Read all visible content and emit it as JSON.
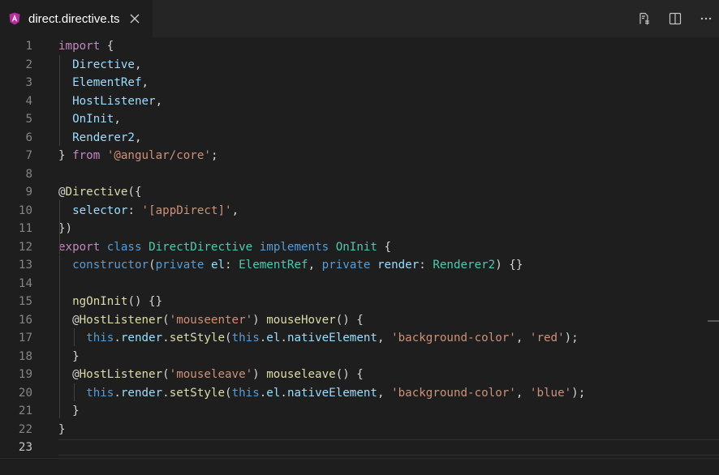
{
  "tab": {
    "filename": "direct.directive.ts",
    "icon": "angular-icon"
  },
  "actions": [
    {
      "name": "open-changes-icon"
    },
    {
      "name": "split-editor-icon"
    },
    {
      "name": "more-actions-icon"
    }
  ],
  "editor": {
    "active_line": 23,
    "lines": [
      {
        "n": "1",
        "tokens": [
          [
            "kw",
            "import"
          ],
          [
            "pu",
            " {"
          ]
        ]
      },
      {
        "n": "2",
        "tokens": [
          [
            "pu",
            "  "
          ],
          [
            "id",
            "Directive"
          ],
          [
            "pu",
            ","
          ]
        ]
      },
      {
        "n": "3",
        "tokens": [
          [
            "pu",
            "  "
          ],
          [
            "id",
            "ElementRef"
          ],
          [
            "pu",
            ","
          ]
        ]
      },
      {
        "n": "4",
        "tokens": [
          [
            "pu",
            "  "
          ],
          [
            "id",
            "HostListener"
          ],
          [
            "pu",
            ","
          ]
        ]
      },
      {
        "n": "5",
        "tokens": [
          [
            "pu",
            "  "
          ],
          [
            "id",
            "OnInit"
          ],
          [
            "pu",
            ","
          ]
        ]
      },
      {
        "n": "6",
        "tokens": [
          [
            "pu",
            "  "
          ],
          [
            "id",
            "Renderer2"
          ],
          [
            "pu",
            ","
          ]
        ]
      },
      {
        "n": "7",
        "tokens": [
          [
            "pu",
            "} "
          ],
          [
            "kw",
            "from"
          ],
          [
            "pu",
            " "
          ],
          [
            "st",
            "'@angular/core'"
          ],
          [
            "pu",
            ";"
          ]
        ]
      },
      {
        "n": "8",
        "tokens": []
      },
      {
        "n": "9",
        "tokens": [
          [
            "pu",
            "@"
          ],
          [
            "fn",
            "Directive"
          ],
          [
            "pu",
            "({"
          ]
        ]
      },
      {
        "n": "10",
        "tokens": [
          [
            "pu",
            "  "
          ],
          [
            "id",
            "selector"
          ],
          [
            "pu",
            ": "
          ],
          [
            "st",
            "'[appDirect]'"
          ],
          [
            "pu",
            ","
          ]
        ]
      },
      {
        "n": "11",
        "tokens": [
          [
            "pu",
            "})"
          ]
        ]
      },
      {
        "n": "12",
        "tokens": [
          [
            "kw",
            "export"
          ],
          [
            "pu",
            " "
          ],
          [
            "kb",
            "class"
          ],
          [
            "pu",
            " "
          ],
          [
            "ty",
            "DirectDirective"
          ],
          [
            "pu",
            " "
          ],
          [
            "kb",
            "implements"
          ],
          [
            "pu",
            " "
          ],
          [
            "ty",
            "OnInit"
          ],
          [
            "pu",
            " {"
          ]
        ]
      },
      {
        "n": "13",
        "tokens": [
          [
            "pu",
            "  "
          ],
          [
            "kb",
            "constructor"
          ],
          [
            "pu",
            "("
          ],
          [
            "kb",
            "private"
          ],
          [
            "pu",
            " "
          ],
          [
            "id",
            "el"
          ],
          [
            "pu",
            ": "
          ],
          [
            "ty",
            "ElementRef"
          ],
          [
            "pu",
            ", "
          ],
          [
            "kb",
            "private"
          ],
          [
            "pu",
            " "
          ],
          [
            "id",
            "render"
          ],
          [
            "pu",
            ": "
          ],
          [
            "ty",
            "Renderer2"
          ],
          [
            "pu",
            ") {}"
          ]
        ]
      },
      {
        "n": "14",
        "tokens": []
      },
      {
        "n": "15",
        "tokens": [
          [
            "pu",
            "  "
          ],
          [
            "fn",
            "ngOnInit"
          ],
          [
            "pu",
            "() {}"
          ]
        ]
      },
      {
        "n": "16",
        "tokens": [
          [
            "pu",
            "  @"
          ],
          [
            "fn",
            "HostListener"
          ],
          [
            "pu",
            "("
          ],
          [
            "st",
            "'mouseenter'"
          ],
          [
            "pu",
            ") "
          ],
          [
            "fn",
            "mouseHover"
          ],
          [
            "pu",
            "() {"
          ]
        ]
      },
      {
        "n": "17",
        "tokens": [
          [
            "pu",
            "    "
          ],
          [
            "kb",
            "this"
          ],
          [
            "pu",
            "."
          ],
          [
            "id",
            "render"
          ],
          [
            "pu",
            "."
          ],
          [
            "fn",
            "setStyle"
          ],
          [
            "pu",
            "("
          ],
          [
            "kb",
            "this"
          ],
          [
            "pu",
            "."
          ],
          [
            "id",
            "el"
          ],
          [
            "pu",
            "."
          ],
          [
            "id",
            "nativeElement"
          ],
          [
            "pu",
            ", "
          ],
          [
            "st",
            "'background-color'"
          ],
          [
            "pu",
            ", "
          ],
          [
            "st",
            "'red'"
          ],
          [
            "pu",
            ");"
          ]
        ]
      },
      {
        "n": "18",
        "tokens": [
          [
            "pu",
            "  }"
          ]
        ]
      },
      {
        "n": "19",
        "tokens": [
          [
            "pu",
            "  @"
          ],
          [
            "fn",
            "HostListener"
          ],
          [
            "pu",
            "("
          ],
          [
            "st",
            "'mouseleave'"
          ],
          [
            "pu",
            ") "
          ],
          [
            "fn",
            "mouseleave"
          ],
          [
            "pu",
            "() {"
          ]
        ]
      },
      {
        "n": "20",
        "tokens": [
          [
            "pu",
            "    "
          ],
          [
            "kb",
            "this"
          ],
          [
            "pu",
            "."
          ],
          [
            "id",
            "render"
          ],
          [
            "pu",
            "."
          ],
          [
            "fn",
            "setStyle"
          ],
          [
            "pu",
            "("
          ],
          [
            "kb",
            "this"
          ],
          [
            "pu",
            "."
          ],
          [
            "id",
            "el"
          ],
          [
            "pu",
            "."
          ],
          [
            "id",
            "nativeElement"
          ],
          [
            "pu",
            ", "
          ],
          [
            "st",
            "'background-color'"
          ],
          [
            "pu",
            ", "
          ],
          [
            "st",
            "'blue'"
          ],
          [
            "pu",
            ");"
          ]
        ]
      },
      {
        "n": "21",
        "tokens": [
          [
            "pu",
            "  }"
          ]
        ]
      },
      {
        "n": "22",
        "tokens": [
          [
            "pu",
            "}"
          ]
        ]
      },
      {
        "n": "23",
        "tokens": []
      }
    ]
  }
}
